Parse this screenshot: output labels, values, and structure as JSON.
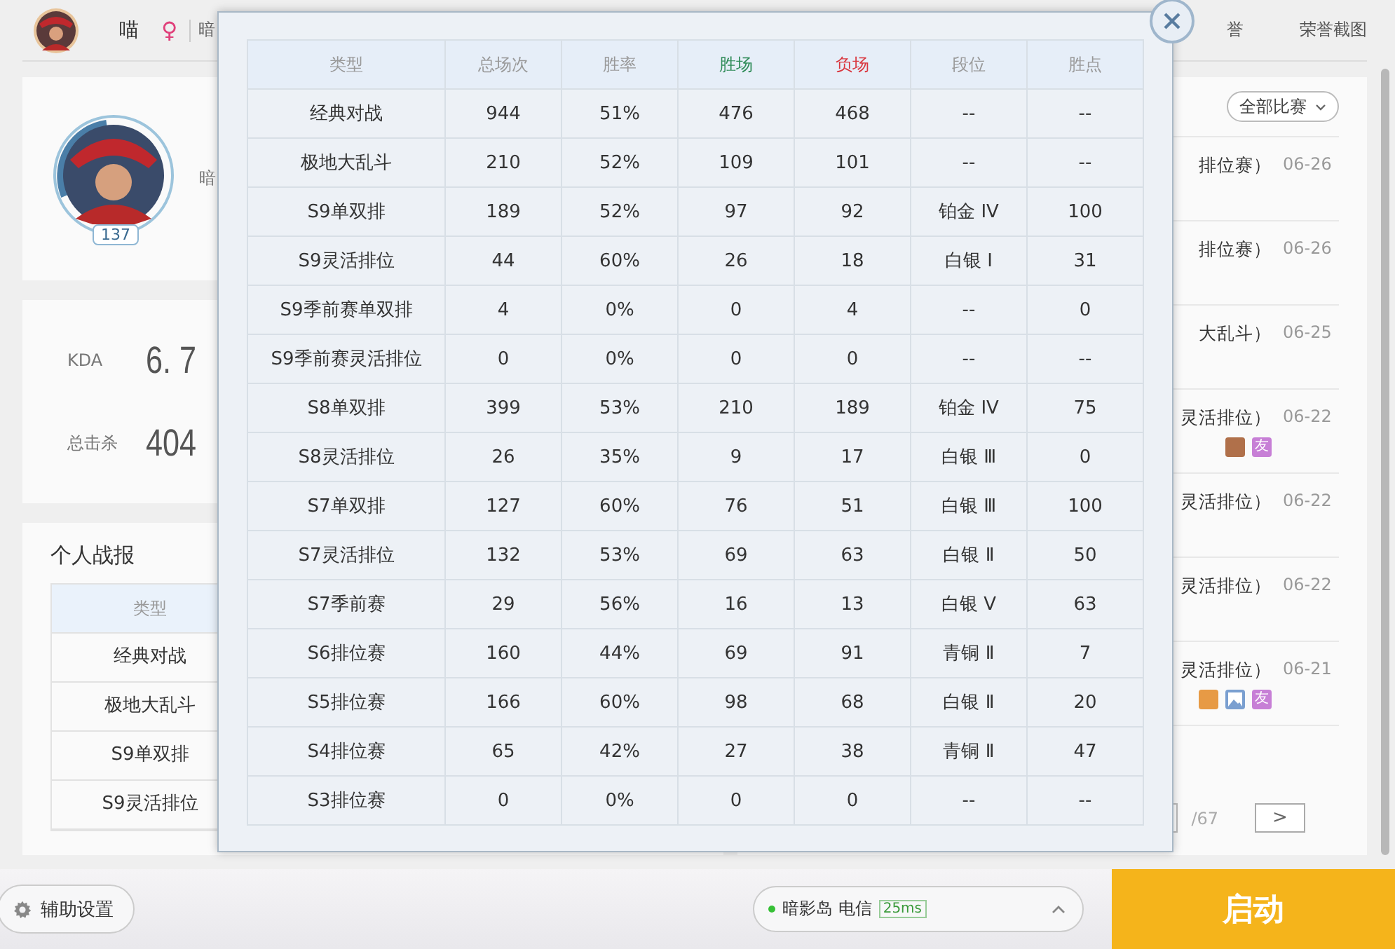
{
  "top_bar": {
    "nickname": "喵",
    "gender_symbol": "♀",
    "server_partial": "暗",
    "tabs": [
      {
        "label": "誉"
      },
      {
        "label": "荣誉截图"
      }
    ]
  },
  "profile": {
    "level": "137",
    "name_partial": "暗"
  },
  "stats": [
    {
      "label": "KDA",
      "value": "6. 7"
    },
    {
      "label": "总击杀",
      "value": "404"
    }
  ],
  "report": {
    "title": "个人战报",
    "column": "类型",
    "rows": [
      "经典对战",
      "极地大乱斗",
      "S9单双排",
      "S9灵活排位"
    ]
  },
  "matches": {
    "filter": "全部比赛",
    "items": [
      {
        "mode": "排位赛）",
        "date": "06-26"
      },
      {
        "mode": "排位赛）",
        "date": "06-26"
      },
      {
        "mode": "大乱斗）",
        "date": "06-25"
      },
      {
        "mode": "灵活排位）",
        "date": "06-22",
        "tags": [
          {
            "kind": "partial",
            "color": "#b0704a"
          },
          {
            "kind": "friend",
            "label": "友",
            "color": "#c77fd6"
          }
        ]
      },
      {
        "mode": "灵活排位）",
        "date": "06-22"
      },
      {
        "mode": "灵活排位）",
        "date": "06-22"
      },
      {
        "mode": "灵活排位）",
        "date": "06-21",
        "tags": [
          {
            "kind": "partial",
            "color": "#e79a45"
          },
          {
            "kind": "image",
            "color": "#7a9fd0"
          },
          {
            "kind": "friend",
            "label": "友",
            "color": "#c77fd6"
          }
        ]
      }
    ],
    "page_total": "/67",
    "next": ">"
  },
  "modal": {
    "columns": [
      {
        "label": "类型",
        "color": "#999999"
      },
      {
        "label": "总场次",
        "color": "#999999"
      },
      {
        "label": "胜率",
        "color": "#999999"
      },
      {
        "label": "胜场",
        "color": "#2e8b57"
      },
      {
        "label": "负场",
        "color": "#d9363e"
      },
      {
        "label": "段位",
        "color": "#999999"
      },
      {
        "label": "胜点",
        "color": "#999999"
      }
    ],
    "rows": [
      [
        "经典对战",
        "944",
        "51%",
        "476",
        "468",
        "--",
        "--"
      ],
      [
        "极地大乱斗",
        "210",
        "52%",
        "109",
        "101",
        "--",
        "--"
      ],
      [
        "S9单双排",
        "189",
        "52%",
        "97",
        "92",
        "铂金 IV",
        "100"
      ],
      [
        "S9灵活排位",
        "44",
        "60%",
        "26",
        "18",
        "白银 Ⅰ",
        "31"
      ],
      [
        "S9季前赛单双排",
        "4",
        "0%",
        "0",
        "4",
        "--",
        "0"
      ],
      [
        "S9季前赛灵活排位",
        "0",
        "0%",
        "0",
        "0",
        "--",
        "--"
      ],
      [
        "S8单双排",
        "399",
        "53%",
        "210",
        "189",
        "铂金 IV",
        "75"
      ],
      [
        "S8灵活排位",
        "26",
        "35%",
        "9",
        "17",
        "白银 Ⅲ",
        "0"
      ],
      [
        "S7单双排",
        "127",
        "60%",
        "76",
        "51",
        "白银 Ⅲ",
        "100"
      ],
      [
        "S7灵活排位",
        "132",
        "53%",
        "69",
        "63",
        "白银 Ⅱ",
        "50"
      ],
      [
        "S7季前赛",
        "29",
        "56%",
        "16",
        "13",
        "白银 Ⅴ",
        "63"
      ],
      [
        "S6排位赛",
        "160",
        "44%",
        "69",
        "91",
        "青铜 Ⅱ",
        "7"
      ],
      [
        "S5排位赛",
        "166",
        "60%",
        "98",
        "68",
        "白银 Ⅱ",
        "20"
      ],
      [
        "S4排位赛",
        "65",
        "42%",
        "27",
        "38",
        "青铜 Ⅱ",
        "47"
      ],
      [
        "S3排位赛",
        "0",
        "0%",
        "0",
        "0",
        "--",
        "--"
      ]
    ]
  },
  "bottom_bar": {
    "settings": "辅助设置",
    "server": {
      "name": "暗影岛 电信",
      "ping": "25ms"
    },
    "launch": "启动"
  }
}
